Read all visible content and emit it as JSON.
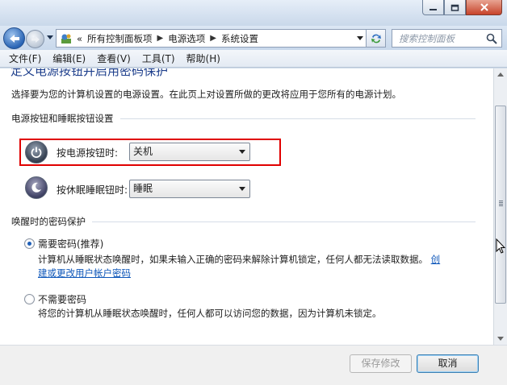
{
  "window": {
    "controls": [
      "minimize-icon",
      "maximize-icon",
      "close-icon"
    ]
  },
  "nav": {
    "breadcrumb_overflow": "«",
    "breadcrumbs": [
      "所有控制面板项",
      "电源选项",
      "系统设置"
    ],
    "search_placeholder": "搜索控制面板"
  },
  "menu": [
    "文件(F)",
    "编辑(E)",
    "查看(V)",
    "工具(T)",
    "帮助(H)"
  ],
  "main": {
    "title": "定义电源按钮并启用密码保护",
    "intro": "选择要为您的计算机设置的电源设置。在此页上对设置所做的更改将应用于您所有的电源计划。",
    "button_section": {
      "heading": "电源按钮和睡眠按钮设置",
      "power_label": "按电源按钮时:",
      "power_value": "关机",
      "sleep_label": "按休眠睡眠钮时:",
      "sleep_value": "睡眠"
    },
    "password_section": {
      "heading": "唤醒时的密码保护",
      "require": {
        "label": "需要密码(推荐)",
        "checked": true,
        "desc_line1": "计算机从睡眠状态唤醒时，如果未输入正确的密码来解除计算机锁定，任何人都无法读取数据。",
        "link_part1": "创",
        "link_part2": "建或更改用户帐户密码"
      },
      "no_require": {
        "label": "不需要密码",
        "checked": false,
        "desc": "将您的计算机从睡眠状态唤醒时，任何人都可以访问您的数据，因为计算机未锁定。"
      }
    }
  },
  "footer": {
    "save_label": "保存修改",
    "cancel_label": "取消"
  },
  "colors": {
    "highlight": "#e00000",
    "link": "#0d56b9",
    "title": "#1e3f8c"
  }
}
